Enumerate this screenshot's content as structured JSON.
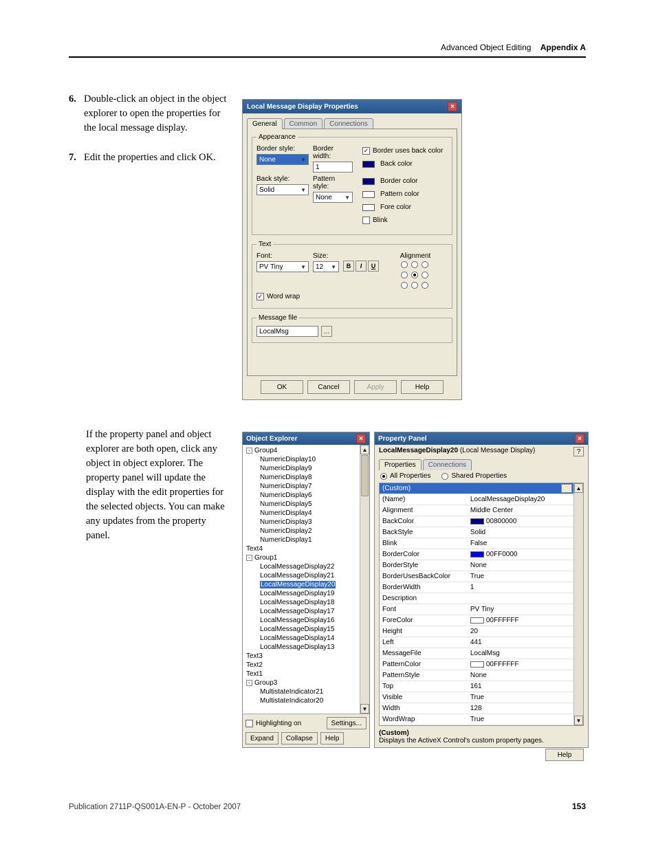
{
  "header": {
    "left": "Advanced Object Editing",
    "right": "Appendix A"
  },
  "steps": [
    {
      "n": "6.",
      "t": "Double-click an object in the object explorer to open the properties for the local message display."
    },
    {
      "n": "7.",
      "t": "Edit the properties and click OK."
    }
  ],
  "para2": "If the property panel and object explorer are both open, click any object in object explorer. The property panel will update the display with the edit properties for the selected objects. You can make any updates from the property panel.",
  "footer": {
    "pub": "Publication 2711P-QS001A-EN-P - October 2007",
    "page": "153"
  },
  "dialog": {
    "title": "Local Message Display Properties",
    "tabs": [
      "General",
      "Common",
      "Connections"
    ],
    "appearance": {
      "legend": "Appearance",
      "borderStyleLabel": "Border style:",
      "borderStyleValue": "None",
      "borderWidthLabel": "Border width:",
      "borderWidthValue": "1",
      "backStyleLabel": "Back style:",
      "backStyleValue": "Solid",
      "patternStyleLabel": "Pattern style:",
      "patternStyleValue": "None",
      "borderUsesBack": "Border uses back color",
      "backColor": "Back color",
      "borderColor": "Border color",
      "patternColor": "Pattern color",
      "foreColor": "Fore color",
      "blink": "Blink"
    },
    "text": {
      "legend": "Text",
      "fontLabel": "Font:",
      "fontValue": "PV Tiny",
      "sizeLabel": "Size:",
      "sizeValue": "12",
      "wordWrap": "Word wrap",
      "alignLabel": "Alignment"
    },
    "msgfile": {
      "legend": "Message file",
      "value": "LocalMsg"
    },
    "buttons": {
      "ok": "OK",
      "cancel": "Cancel",
      "apply": "Apply",
      "help": "Help"
    }
  },
  "objectExplorer": {
    "title": "Object Explorer",
    "nodes": [
      {
        "lvl": 0,
        "tog": "-",
        "name": "Group4"
      },
      {
        "lvl": 1,
        "name": "NumericDisplay10"
      },
      {
        "lvl": 1,
        "name": "NumericDisplay9"
      },
      {
        "lvl": 1,
        "name": "NumericDisplay8"
      },
      {
        "lvl": 1,
        "name": "NumericDisplay7"
      },
      {
        "lvl": 1,
        "name": "NumericDisplay6"
      },
      {
        "lvl": 1,
        "name": "NumericDisplay5"
      },
      {
        "lvl": 1,
        "name": "NumericDisplay4"
      },
      {
        "lvl": 1,
        "name": "NumericDisplay3"
      },
      {
        "lvl": 1,
        "name": "NumericDisplay2"
      },
      {
        "lvl": 1,
        "name": "NumericDisplay1"
      },
      {
        "lvl": 0,
        "name": "Text4"
      },
      {
        "lvl": 0,
        "tog": "-",
        "name": "Group1"
      },
      {
        "lvl": 1,
        "name": "LocalMessageDisplay22"
      },
      {
        "lvl": 1,
        "name": "LocalMessageDisplay21"
      },
      {
        "lvl": 1,
        "name": "LocalMessageDisplay20",
        "sel": true
      },
      {
        "lvl": 1,
        "name": "LocalMessageDisplay19"
      },
      {
        "lvl": 1,
        "name": "LocalMessageDisplay18"
      },
      {
        "lvl": 1,
        "name": "LocalMessageDisplay17"
      },
      {
        "lvl": 1,
        "name": "LocalMessageDisplay16"
      },
      {
        "lvl": 1,
        "name": "LocalMessageDisplay15"
      },
      {
        "lvl": 1,
        "name": "LocalMessageDisplay14"
      },
      {
        "lvl": 1,
        "name": "LocalMessageDisplay13"
      },
      {
        "lvl": 0,
        "name": "Text3"
      },
      {
        "lvl": 0,
        "name": "Text2"
      },
      {
        "lvl": 0,
        "name": "Text1"
      },
      {
        "lvl": 0,
        "tog": "-",
        "name": "Group3"
      },
      {
        "lvl": 1,
        "name": "MultistateIndicator21"
      },
      {
        "lvl": 1,
        "name": "MultistateIndicator20"
      }
    ],
    "highlight": "Highlighting on",
    "settings": "Settings...",
    "expand": "Expand",
    "collapse": "Collapse",
    "help": "Help"
  },
  "propertyPanel": {
    "title": "Property Panel",
    "objectName": "LocalMessageDisplay20",
    "objectType": "(Local Message Display)",
    "tabs": [
      "Properties",
      "Connections"
    ],
    "filterAll": "All Properties",
    "filterShared": "Shared Properties",
    "rows": [
      {
        "k": "(Custom)",
        "v": "",
        "sel": true,
        "ell": true
      },
      {
        "k": "(Name)",
        "v": "LocalMessageDisplay20"
      },
      {
        "k": "Alignment",
        "v": "Middle Center"
      },
      {
        "k": "BackColor",
        "v": "00800000",
        "sw": "#000080"
      },
      {
        "k": "BackStyle",
        "v": "Solid"
      },
      {
        "k": "Blink",
        "v": "False"
      },
      {
        "k": "BorderColor",
        "v": "00FF0000",
        "sw": "#0000ff"
      },
      {
        "k": "BorderStyle",
        "v": "None"
      },
      {
        "k": "BorderUsesBackColor",
        "v": "True"
      },
      {
        "k": "BorderWidth",
        "v": "1"
      },
      {
        "k": "Description",
        "v": ""
      },
      {
        "k": "Font",
        "v": "PV Tiny"
      },
      {
        "k": "ForeColor",
        "v": "00FFFFFF",
        "sw": "#ffffff"
      },
      {
        "k": "Height",
        "v": "20"
      },
      {
        "k": "Left",
        "v": "441"
      },
      {
        "k": "MessageFile",
        "v": "LocalMsg"
      },
      {
        "k": "PatternColor",
        "v": "00FFFFFF",
        "sw": "#ffffff"
      },
      {
        "k": "PatternStyle",
        "v": "None"
      },
      {
        "k": "Top",
        "v": "161"
      },
      {
        "k": "Visible",
        "v": "True"
      },
      {
        "k": "Width",
        "v": "128"
      },
      {
        "k": "WordWrap",
        "v": "True"
      }
    ],
    "descTitle": "(Custom)",
    "descText": "Displays the ActiveX Control's custom property pages.",
    "help": "Help"
  }
}
